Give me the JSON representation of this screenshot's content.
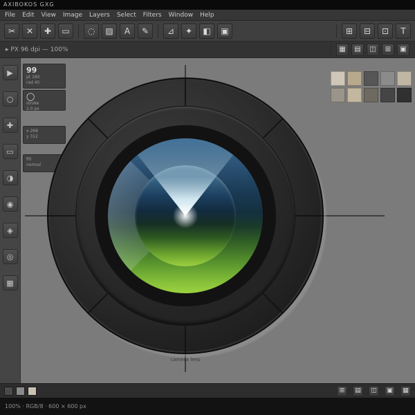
{
  "title_bar": {
    "title": "AXIBOKOS GXG"
  },
  "menu_bar": {
    "items": [
      "File",
      "Edit",
      "View",
      "Image",
      "Layers",
      "Select",
      "Filters",
      "Window",
      "Help"
    ]
  },
  "toolbar_main": {
    "icons": [
      {
        "name": "cut",
        "glyph": "✂"
      },
      {
        "name": "close",
        "glyph": "✕"
      },
      {
        "name": "move",
        "glyph": "✚"
      },
      {
        "name": "crop",
        "glyph": "▭"
      },
      {
        "name": "lasso",
        "glyph": "◌"
      },
      {
        "name": "pattern",
        "glyph": "▨"
      },
      {
        "name": "text",
        "glyph": "A"
      },
      {
        "name": "pen",
        "glyph": "✎"
      },
      {
        "name": "shear",
        "glyph": "⊿"
      },
      {
        "name": "star",
        "glyph": "✦"
      },
      {
        "name": "gradient",
        "glyph": "◧"
      },
      {
        "name": "erase",
        "glyph": "▣"
      }
    ],
    "right_icons": [
      {
        "name": "grid",
        "glyph": "⊞"
      },
      {
        "name": "layout",
        "glyph": "⊟"
      },
      {
        "name": "panel",
        "glyph": "⊡"
      },
      {
        "name": "type",
        "glyph": "T"
      }
    ]
  },
  "toolbar_options": {
    "label": "▸ PX  96 dpi  —  100%",
    "right_icons": [
      {
        "name": "tile-view",
        "glyph": "▦"
      },
      {
        "name": "list-view",
        "glyph": "▤"
      },
      {
        "name": "split-view",
        "glyph": "◫"
      },
      {
        "name": "snap-grid",
        "glyph": "⊞"
      },
      {
        "name": "lock",
        "glyph": "▣"
      }
    ]
  },
  "tool_panel": {
    "tools": [
      {
        "name": "select-tool",
        "glyph": "▶"
      },
      {
        "name": "ellipse-tool",
        "glyph": "○"
      },
      {
        "name": "crosshair-tool",
        "glyph": "✚"
      },
      {
        "name": "rectangle-tool",
        "glyph": "▭"
      },
      {
        "name": "rotate-tool",
        "glyph": "◑"
      },
      {
        "name": "target-tool",
        "glyph": "◉"
      },
      {
        "name": "shape-tool",
        "glyph": "◈"
      },
      {
        "name": "circle-tool",
        "glyph": "◎"
      },
      {
        "name": "grid-tool",
        "glyph": "▦"
      }
    ]
  },
  "side_panels": [
    {
      "title": "99",
      "line1": "pt 180",
      "line2": "rad 45"
    },
    {
      "title": "◯",
      "line1": "stroke",
      "line2": "2.0 px"
    },
    {
      "title": "",
      "line1": "x 268",
      "line2": "y 312"
    },
    {
      "title": "",
      "line1": "fill",
      "line2": "normal"
    }
  ],
  "canvas": {
    "caption": "camera lens",
    "lens_colors": {
      "blue": "#2b5173",
      "green": "#8ac43a",
      "barrel": "#2e2e2e",
      "highlight": "#f2fbfd"
    }
  },
  "swatches": {
    "colors": [
      "#cfc6b8",
      "#b9a98c",
      "#565656",
      "#8b8b8b",
      "#c0b6a4",
      "#9a948a",
      "#c3b79f",
      "#6e6a60",
      "#454545",
      "#303030"
    ]
  },
  "bottom_bar": {
    "wells": [
      "#4a4a4a",
      "#8a8a8a",
      "#c9c2b4"
    ],
    "icons": [
      {
        "name": "thumbnail-grid",
        "glyph": "⊞"
      },
      {
        "name": "page-list",
        "glyph": "▤"
      },
      {
        "name": "dual-page",
        "glyph": "◫"
      },
      {
        "name": "bookmark",
        "glyph": "▣"
      },
      {
        "name": "options",
        "glyph": "▦"
      }
    ]
  },
  "status_bar": {
    "text": "100%   ·   RGB/8   ·   600 × 600 px"
  }
}
